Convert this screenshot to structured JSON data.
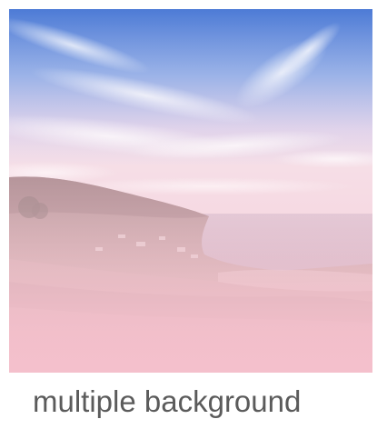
{
  "caption": "multiple background",
  "colors": {
    "sky_top": "#4f7fd8",
    "sky_mid": "#9fb4ea",
    "haze": "#f1d9e3",
    "sea": "#c7b4c7",
    "land": "#c39c9c",
    "overlay_pink": "#f4c0cc",
    "caption_text": "#5b5b5b"
  }
}
